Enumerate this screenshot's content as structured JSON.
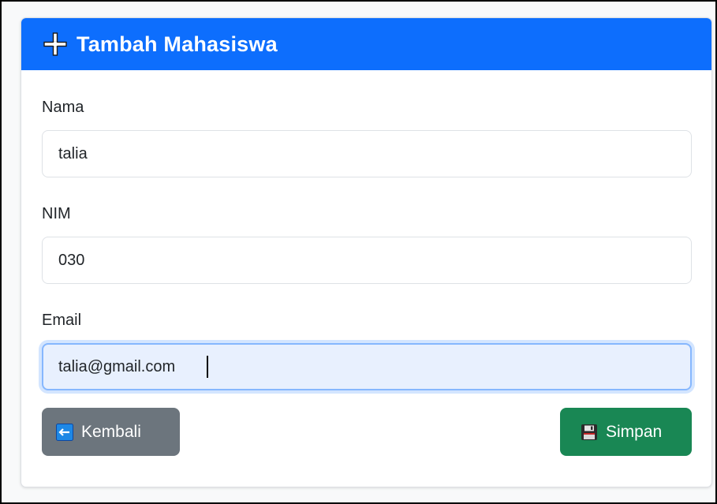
{
  "header": {
    "title": "Tambah Mahasiswa",
    "icon": "plus-icon",
    "color": "#0d6efd"
  },
  "form": {
    "nama": {
      "label": "Nama",
      "value": "talia"
    },
    "nim": {
      "label": "NIM",
      "value": "030"
    },
    "email": {
      "label": "Email",
      "value": "talia@gmail.com",
      "focused": true
    }
  },
  "actions": {
    "back": {
      "label": "Kembali",
      "icon": "left-arrow-icon",
      "color": "#6c757d"
    },
    "save": {
      "label": "Simpan",
      "icon": "floppy-disk-icon",
      "color": "#198754"
    }
  }
}
